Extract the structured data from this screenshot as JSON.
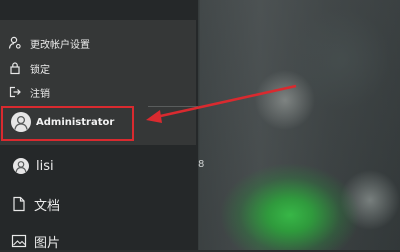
{
  "flyout": {
    "items": [
      {
        "label": "更改帐户设置",
        "icon": "person-gear-icon"
      },
      {
        "label": "锁定",
        "icon": "lock-icon"
      },
      {
        "label": "注销",
        "icon": "sign-out-icon"
      }
    ],
    "current_account": {
      "label": "Administrator",
      "icon": "avatar-icon"
    }
  },
  "menu": {
    "items": [
      {
        "label": "lisi",
        "icon": "avatar-icon"
      },
      {
        "label": "文档",
        "icon": "document-icon"
      },
      {
        "label": "图片",
        "icon": "picture-icon"
      }
    ]
  },
  "tiles": {
    "side_number": "8"
  },
  "colors": {
    "highlight": "#d92a2f",
    "menu_bg": "#252829",
    "flyout_bg": "#353737",
    "tile_green": "#39d04a"
  }
}
